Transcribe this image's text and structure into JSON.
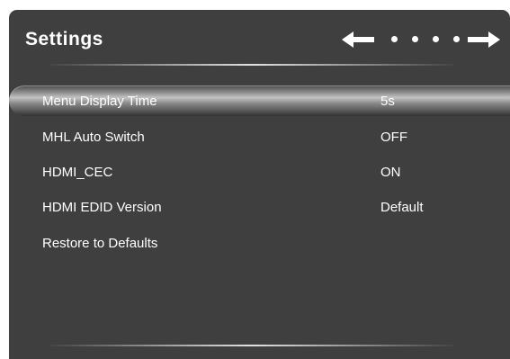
{
  "header": {
    "title": "Settings",
    "nav_left_icon": "arrow-left-icon",
    "nav_right_icon": "arrow-right-icon"
  },
  "menu": {
    "items": [
      {
        "label": "Menu Display Time",
        "value": "5s",
        "selected": true
      },
      {
        "label": "MHL Auto Switch",
        "value": "OFF",
        "selected": false
      },
      {
        "label": "HDMI_CEC",
        "value": "ON",
        "selected": false
      },
      {
        "label": "HDMI EDID Version",
        "value": "Default",
        "selected": false
      },
      {
        "label": "Restore to Defaults",
        "value": "",
        "selected": false
      }
    ]
  },
  "colors": {
    "panel_background": "#3f3f3f",
    "text": "#ffffff",
    "highlight": "#c3c3c3"
  }
}
